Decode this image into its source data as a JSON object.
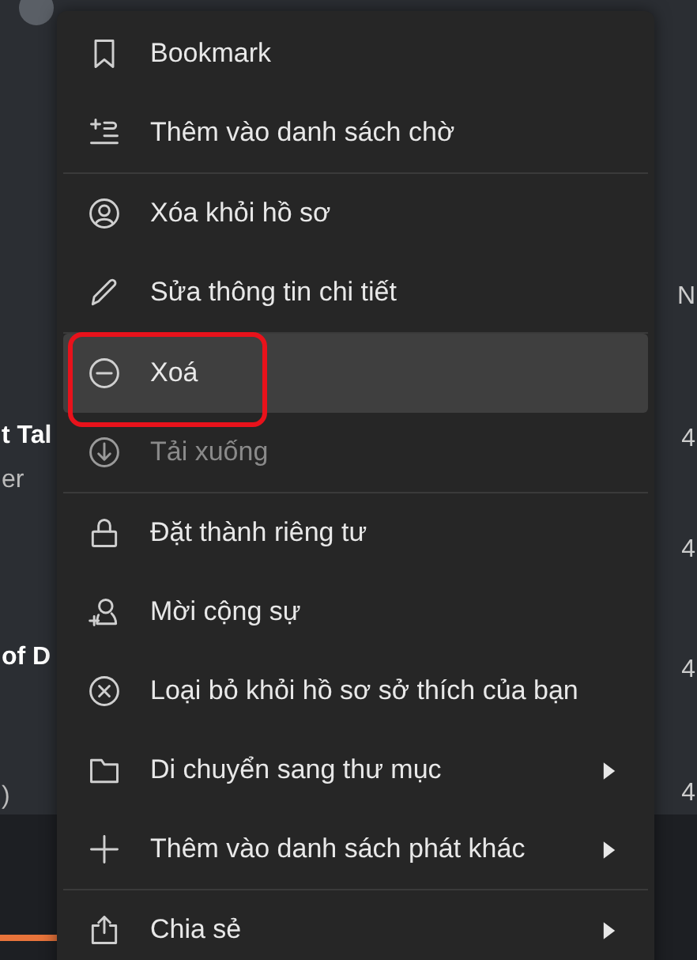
{
  "background": {
    "left_fragments": [
      "t Tal",
      "er",
      "of D",
      ")"
    ],
    "right_heading": "N",
    "right_numbers": [
      "4",
      "4",
      "4",
      "4"
    ]
  },
  "menu": {
    "items": [
      {
        "label": "Bookmark",
        "selected": false,
        "disabled": false,
        "submenu": false,
        "outlined": false
      },
      {
        "label": "Thêm vào danh sách chờ",
        "selected": false,
        "disabled": false,
        "submenu": false,
        "outlined": false
      },
      {
        "label": "Xóa khỏi hồ sơ",
        "selected": false,
        "disabled": false,
        "submenu": false,
        "outlined": false
      },
      {
        "label": "Sửa thông tin chi tiết",
        "selected": false,
        "disabled": false,
        "submenu": false,
        "outlined": false
      },
      {
        "label": "Xoá",
        "selected": true,
        "disabled": false,
        "submenu": false,
        "outlined": true
      },
      {
        "label": "Tải xuống",
        "selected": false,
        "disabled": true,
        "submenu": false,
        "outlined": false
      },
      {
        "label": "Đặt thành riêng tư",
        "selected": false,
        "disabled": false,
        "submenu": false,
        "outlined": false
      },
      {
        "label": "Mời cộng sự",
        "selected": false,
        "disabled": false,
        "submenu": false,
        "outlined": false
      },
      {
        "label": "Loại bỏ khỏi hồ sơ sở thích của bạn",
        "selected": false,
        "disabled": false,
        "submenu": false,
        "outlined": false
      },
      {
        "label": "Di chuyển sang thư mục",
        "selected": false,
        "disabled": false,
        "submenu": true,
        "outlined": false
      },
      {
        "label": "Thêm vào danh sách phát khác",
        "selected": false,
        "disabled": false,
        "submenu": true,
        "outlined": false
      },
      {
        "label": "Chia sẻ",
        "selected": false,
        "disabled": false,
        "submenu": true,
        "outlined": false
      }
    ]
  }
}
